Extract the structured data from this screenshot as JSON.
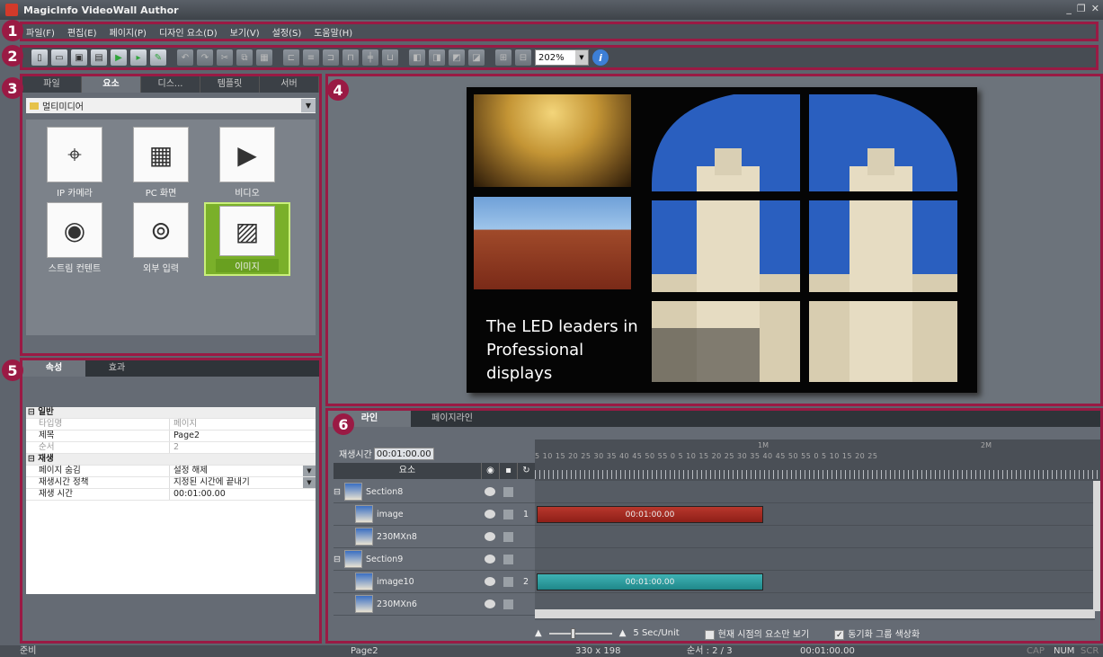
{
  "window": {
    "title": "MagicInfo VideoWall Author"
  },
  "badges": [
    "1",
    "2",
    "3",
    "4",
    "5",
    "6"
  ],
  "menu": [
    "파일(F)",
    "편집(E)",
    "페이지(P)",
    "디자인 요소(D)",
    "보기(V)",
    "설정(S)",
    "도움말(H)"
  ],
  "toolbar": {
    "zoom": "202%"
  },
  "left_tabs": [
    "파일",
    "요소",
    "디스...",
    "템플릿",
    "서버"
  ],
  "left_active_tab": "요소",
  "category": "멀티미디어",
  "elements": [
    {
      "label": "IP 카메라",
      "icon": "camera-icon"
    },
    {
      "label": "PC 화면",
      "icon": "pc-screen-icon"
    },
    {
      "label": "비디오",
      "icon": "video-icon"
    },
    {
      "label": "스트림 컨텐트",
      "icon": "stream-icon"
    },
    {
      "label": "외부 입력",
      "icon": "external-input-icon"
    },
    {
      "label": "이미지",
      "icon": "image-icon"
    }
  ],
  "canvas": {
    "tagline_line1": "The LED leaders in",
    "tagline_line2": "Professional displays"
  },
  "prop_tabs": [
    "속성",
    "효과"
  ],
  "properties": {
    "group_general": "일반",
    "group_play": "재생",
    "rows": [
      {
        "key": "타입명",
        "value": "페이지",
        "readonly": true
      },
      {
        "key": "제목",
        "value": "Page2",
        "readonly": false
      },
      {
        "key": "순서",
        "value": "2",
        "readonly": true
      },
      {
        "key": "페이지 숨김",
        "value": "설정 해제",
        "readonly": false
      },
      {
        "key": "재생시간 정책",
        "value": "지정된 시간에 끝내기",
        "readonly": false
      },
      {
        "key": "재생 시간",
        "value": "00:01:00.00",
        "readonly": false
      }
    ]
  },
  "timeline": {
    "tabs": [
      "라인",
      "페이지라인"
    ],
    "playtime_label": "재생시간",
    "playtime_value": "00:01:00.00",
    "col_element": "요소",
    "ruler_text": "5  10  15  20  25  30  35  40  45  50  55  0   5  10  15  20  25  30  35  40  45  50  55  0   5  10  15  20  25",
    "ruler_1m": "1M",
    "ruler_2m": "2M",
    "rows": [
      {
        "name": "Section8",
        "num": ""
      },
      {
        "name": "image",
        "num": "1"
      },
      {
        "name": "230MXn8",
        "num": ""
      },
      {
        "name": "Section9",
        "num": ""
      },
      {
        "name": "image10",
        "num": "2"
      },
      {
        "name": "230MXn6",
        "num": ""
      }
    ],
    "clip1": "00:01:00.00",
    "clip2": "00:01:00.00",
    "unit": "5 Sec/Unit",
    "chk_current": "현재 시점의 요소만 보기",
    "chk_sync": "동기화 그룹 색상화"
  },
  "status": {
    "state": "준비",
    "page": "Page2",
    "size": "330 x 198",
    "order": "순서 : 2 / 3",
    "time": "00:01:00.00",
    "cap": "CAP",
    "num": "NUM",
    "scr": "SCR"
  },
  "colors": {
    "accent_border": "#9a1a44",
    "clip_red": "#a52a22",
    "clip_teal": "#2a9a9c",
    "selected_tile": "#7ab02a"
  }
}
